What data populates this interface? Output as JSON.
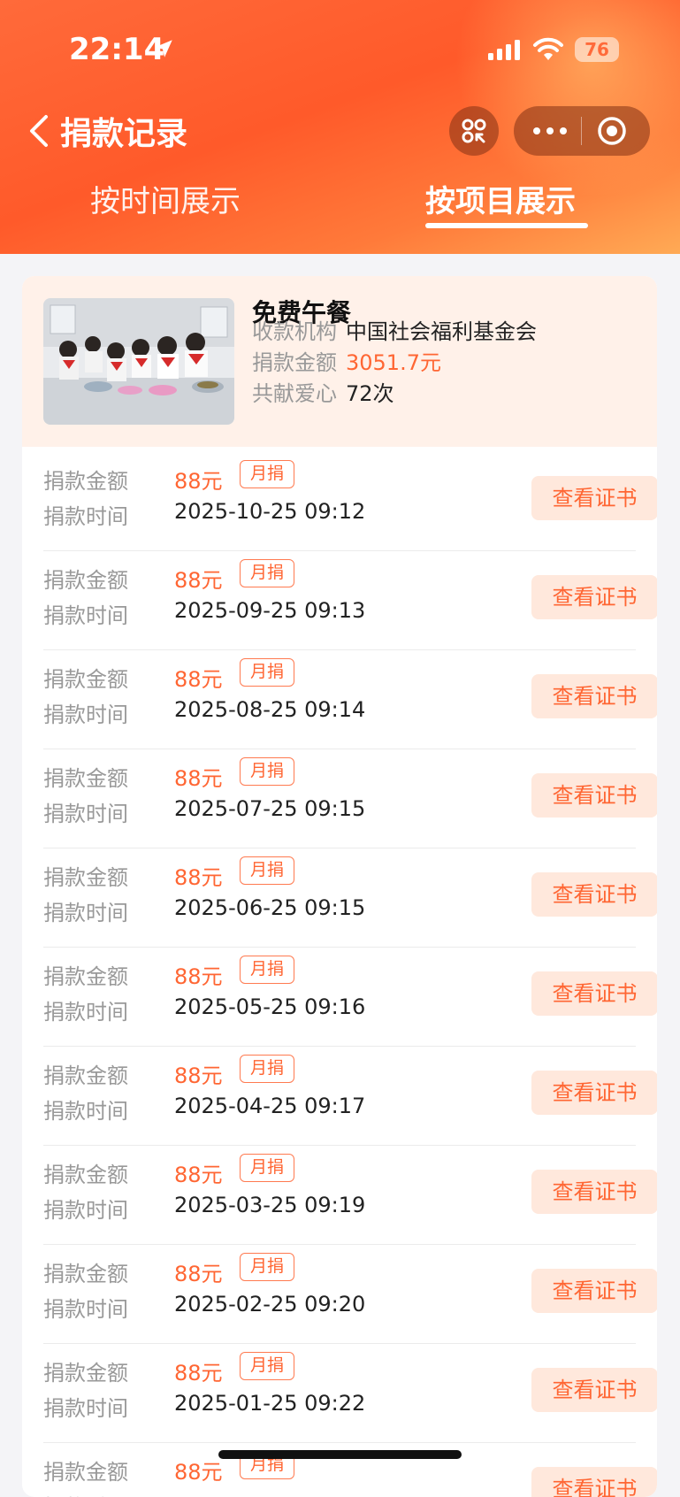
{
  "status_bar": {
    "time": "22:14",
    "battery": "76",
    "icons": [
      "location-arrow-icon",
      "signal-icon",
      "wifi-icon",
      "battery-icon"
    ]
  },
  "nav": {
    "back_icon": "chevron-left-icon",
    "title": "捐款记录",
    "scan_icon": "scan-icon",
    "more_icon": "more-dots-icon",
    "target_icon": "record-target-icon"
  },
  "tabs": [
    {
      "label": "按时间展示",
      "active": false
    },
    {
      "label": "按项目展示",
      "active": true
    }
  ],
  "project": {
    "image": "children-eating-lunch-photo",
    "title": "免费午餐",
    "org_label": "收款机构",
    "org_value": "中国社会福利基金会",
    "amount_label": "捐款金额",
    "amount_value": "3051.7元",
    "count_label": "共献爱心",
    "count_value": "72次"
  },
  "record_labels": {
    "amount": "捐款金额",
    "time": "捐款时间",
    "button": "查看证书"
  },
  "records": [
    {
      "amount": "88元",
      "tag": "月捐",
      "time": "2025-10-25 09:12"
    },
    {
      "amount": "88元",
      "tag": "月捐",
      "time": "2025-09-25 09:13"
    },
    {
      "amount": "88元",
      "tag": "月捐",
      "time": "2025-08-25 09:14"
    },
    {
      "amount": "88元",
      "tag": "月捐",
      "time": "2025-07-25 09:15"
    },
    {
      "amount": "88元",
      "tag": "月捐",
      "time": "2025-06-25 09:15"
    },
    {
      "amount": "88元",
      "tag": "月捐",
      "time": "2025-05-25 09:16"
    },
    {
      "amount": "88元",
      "tag": "月捐",
      "time": "2025-04-25 09:17"
    },
    {
      "amount": "88元",
      "tag": "月捐",
      "time": "2025-03-25 09:19"
    },
    {
      "amount": "88元",
      "tag": "月捐",
      "time": "2025-02-25 09:20"
    },
    {
      "amount": "88元",
      "tag": "月捐",
      "time": "2025-01-25 09:22"
    },
    {
      "amount": "88元",
      "tag": "月捐",
      "time": ""
    }
  ],
  "colors": {
    "accent": "#ff6633",
    "header_start": "#ff5a2a",
    "header_end": "#ffaa55",
    "card_tint": "#fff1e9",
    "button_bg": "#ffe8dc"
  }
}
